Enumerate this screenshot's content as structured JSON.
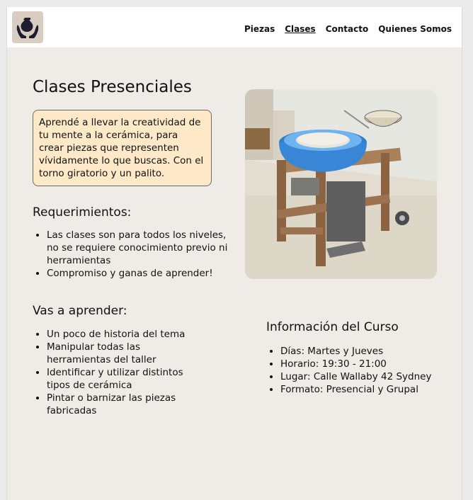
{
  "header": {
    "logo_icon": "pottery-vase-hands-icon",
    "nav": [
      {
        "label": "Piezas"
      },
      {
        "label": "Clases"
      },
      {
        "label": "Contacto"
      },
      {
        "label": "Quienes Somos"
      }
    ],
    "active_nav": "Clases"
  },
  "main": {
    "title": "Clases Presenciales",
    "intro": "Aprendé a llevar la creatividad de tu mente a la cerámica, para crear piezas que representen vívidamente lo que buscas. Con el torno giratorio y un palito.",
    "requirements": {
      "heading": "Requerimientos:",
      "items": [
        "Las clases son para todos los niveles, no se requiere conocimiento previo ni herramientas",
        "Compromiso y ganas de aprender!"
      ]
    },
    "learn": {
      "heading": "Vas a aprender:",
      "items": [
        "Un poco de historia del tema",
        "Manipular todas las herramientas del taller",
        "Identificar y utilizar distintos tipos de cerámica",
        "Pintar o barnizar las piezas fabricadas"
      ]
    },
    "course_info": {
      "heading": "Información del Curso",
      "items": [
        "Días: Martes y Jueves",
        "Horario: 19:30 - 21:00",
        "Lugar: Calle Wallaby 42 Sydney",
        "Formato: Presencial y Grupal"
      ]
    },
    "photo_icon": "pottery-wheel-photo"
  },
  "colors": {
    "page_bg": "#efece7",
    "header_bg": "#ffffff",
    "intro_bg": "#fde9c8",
    "logo_bg": "#d9cdc2"
  }
}
